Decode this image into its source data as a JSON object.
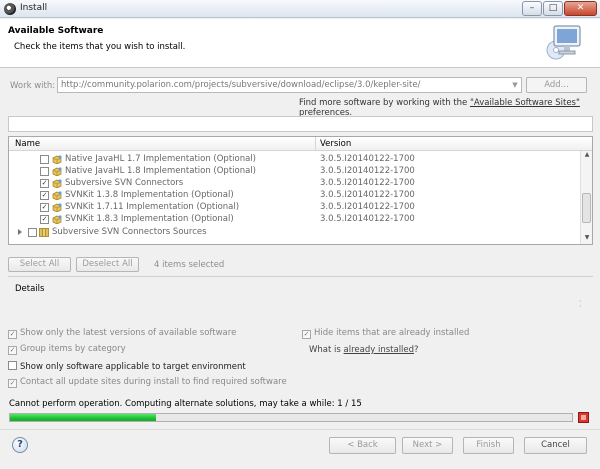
{
  "window": {
    "title": "Install",
    "min_icon": "minimize-icon",
    "max_icon": "maximize-icon",
    "close_icon": "close-icon"
  },
  "banner": {
    "title": "Available Software",
    "message": "Check the items that you wish to install."
  },
  "work_with": {
    "label": "Work with:",
    "url": "http://community.polarion.com/projects/subversive/download/eclipse/3.0/kepler-site/",
    "add_label": "Add...",
    "find_more_prefix": "Find more software by working with the ",
    "find_more_link": "\"Available Software Sites\"",
    "find_more_suffix": " preferences."
  },
  "table": {
    "columns": [
      "Name",
      "Version"
    ],
    "rows": [
      {
        "name": "Native JavaHL 1.7 Implementation (Optional)",
        "version": "3.0.5.I20140122-1700",
        "checked": false
      },
      {
        "name": "Native JavaHL 1.8 Implementation (Optional)",
        "version": "3.0.5.I20140122-1700",
        "checked": false
      },
      {
        "name": "Subversive SVN Connectors",
        "version": "3.0.5.I20140122-1700",
        "checked": true
      },
      {
        "name": "SVNKit 1.3.8 Implementation (Optional)",
        "version": "3.0.5.I20140122-1700",
        "checked": true
      },
      {
        "name": "SVNKit 1.7.11 Implementation (Optional)",
        "version": "3.0.5.I20140122-1700",
        "checked": true
      },
      {
        "name": "SVNKit 1.8.3 Implementation (Optional)",
        "version": "3.0.5.I20140122-1700",
        "checked": true
      }
    ],
    "category": {
      "name": "Subversive SVN Connectors Sources",
      "checked": false
    }
  },
  "selection": {
    "select_all": "Select All",
    "deselect_all": "Deselect All",
    "count_text": "4 items selected"
  },
  "details": {
    "label": "Details"
  },
  "options": {
    "latest": {
      "label": "Show only the latest versions of available software",
      "checked": true
    },
    "hide": {
      "label": "Hide items that are already installed",
      "checked": true
    },
    "group": {
      "label": "Group items by category",
      "checked": true
    },
    "applicable": {
      "label": "Show only software applicable to target environment",
      "checked": false
    },
    "contact": {
      "label": "Contact all update sites during install to find required software",
      "checked": true
    },
    "what_installed_prefix": "What is ",
    "what_installed_link": "already installed",
    "what_installed_suffix": "?"
  },
  "status": {
    "message": "Cannot perform operation. Computing alternate solutions, may take a while: 1 / 15",
    "progress": 0.26
  },
  "buttons": {
    "help": "?",
    "back": "< Back",
    "next": "Next >",
    "finish": "Finish",
    "cancel": "Cancel"
  },
  "colors": {
    "progress": "#1fc033",
    "stop": "#d9372b"
  }
}
